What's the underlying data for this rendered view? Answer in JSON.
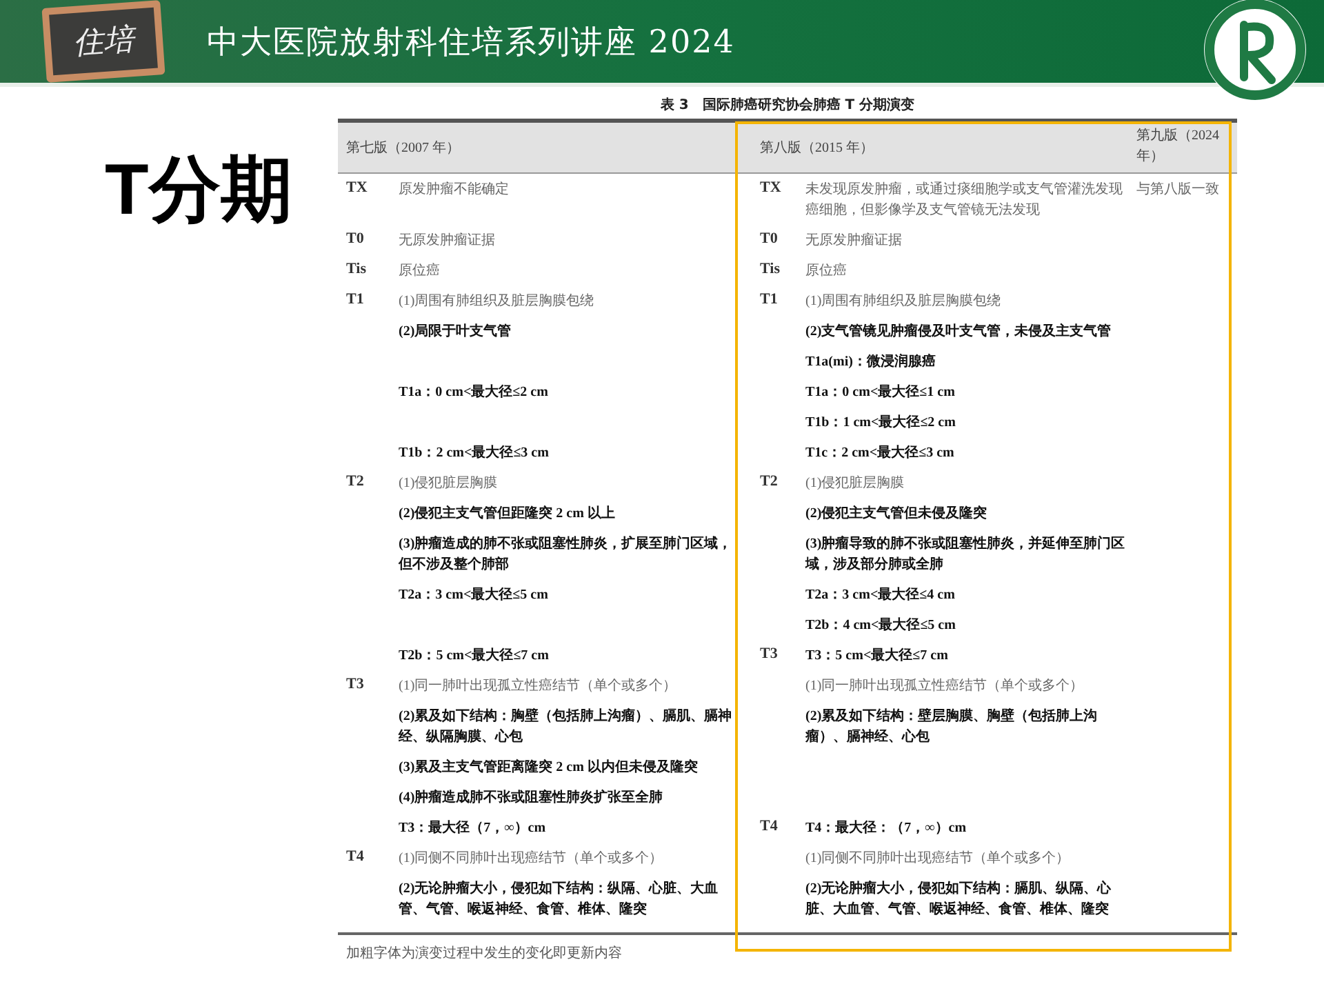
{
  "header": {
    "badge": "住培",
    "title": "中大医院放射科住培系列讲座 2024"
  },
  "heading": "T分期",
  "table": {
    "caption": "表 3　国际肺癌研究协会肺癌 T 分期演变",
    "columns": [
      "第七版（2007 年）",
      "第八版（2015 年）",
      "第九版（2024 年）"
    ],
    "rows": [
      {
        "code_7": "TX",
        "text_7": "原发肿瘤不能确定",
        "bold_7": false,
        "code_8": "TX",
        "text_8": "未发现原发肿瘤，或通过痰细胞学或支气管灌洗发现癌细胞，但影像学及支气管镜无法发现",
        "bold_8": false,
        "text_9": "与第八版一致"
      },
      {
        "code_7": "T0",
        "text_7": "无原发肿瘤证据",
        "bold_7": false,
        "code_8": "T0",
        "text_8": "无原发肿瘤证据",
        "bold_8": false
      },
      {
        "code_7": "Tis",
        "text_7": "原位癌",
        "bold_7": false,
        "code_8": "Tis",
        "text_8": "原位癌",
        "bold_8": false
      },
      {
        "code_7": "T1",
        "text_7": "(1)周围有肺组织及脏层胸膜包绕",
        "bold_7": false,
        "code_8": "T1",
        "text_8": "(1)周围有肺组织及脏层胸膜包绕",
        "bold_8": false
      },
      {
        "text_7": "(2)局限于叶支气管",
        "bold_7": true,
        "text_8": "(2)支气管镜见肿瘤侵及叶支气管，未侵及主支气管",
        "bold_8": true
      },
      {
        "text_8": "T1a(mi)：微浸润腺癌",
        "bold_8": true
      },
      {
        "text_7": "T1a：0 cm<最大径≤2 cm",
        "bold_7": true,
        "text_8": "T1a：0 cm<最大径≤1 cm",
        "bold_8": true
      },
      {
        "text_8": "T1b：1 cm<最大径≤2 cm",
        "bold_8": true
      },
      {
        "text_7": "T1b：2 cm<最大径≤3 cm",
        "bold_7": true,
        "text_8": "T1c：2 cm<最大径≤3 cm",
        "bold_8": true
      },
      {
        "code_7": "T2",
        "text_7": "(1)侵犯脏层胸膜",
        "bold_7": false,
        "code_8": "T2",
        "text_8": "(1)侵犯脏层胸膜",
        "bold_8": false
      },
      {
        "text_7": "(2)侵犯主支气管但距隆突 2 cm 以上",
        "bold_7": true,
        "text_8": "(2)侵犯主支气管但未侵及隆突",
        "bold_8": true
      },
      {
        "text_7": "(3)肿瘤造成的肺不张或阻塞性肺炎，扩展至肺门区域，但不涉及整个肺部",
        "bold_7": true,
        "text_8": "(3)肿瘤导致的肺不张或阻塞性肺炎，并延伸至肺门区域，涉及部分肺或全肺",
        "bold_8": true
      },
      {
        "text_7": "T2a：3 cm<最大径≤5 cm",
        "bold_7": true,
        "text_8": "T2a：3 cm<最大径≤4 cm",
        "bold_8": true
      },
      {
        "text_8": "T2b：4 cm<最大径≤5 cm",
        "bold_8": true
      },
      {
        "text_7": "T2b：5 cm<最大径≤7 cm",
        "bold_7": true,
        "code_8": "T3",
        "text_8": "T3：5 cm<最大径≤7 cm",
        "bold_8": true
      },
      {
        "code_7": "T3",
        "text_7": "(1)同一肺叶出现孤立性癌结节（单个或多个）",
        "bold_7": false,
        "text_8": "(1)同一肺叶出现孤立性癌结节（单个或多个）",
        "bold_8": false
      },
      {
        "text_7": "(2)累及如下结构：胸壁（包括肺上沟瘤）、膈肌、膈神经、纵隔胸膜、心包",
        "bold_7": true,
        "text_8": "(2)累及如下结构：壁层胸膜、胸壁（包括肺上沟瘤）、膈神经、心包",
        "bold_8": true
      },
      {
        "text_7": "(3)累及主支气管距离隆突 2 cm 以内但未侵及隆突",
        "bold_7": true
      },
      {
        "text_7": "(4)肿瘤造成肺不张或阻塞性肺炎扩张至全肺",
        "bold_7": true
      },
      {
        "text_7": "T3：最大径（7，∞）cm",
        "bold_7": true,
        "code_8": "T4",
        "text_8": "T4：最大径：（7，∞）cm",
        "bold_8": true
      },
      {
        "code_7": "T4",
        "text_7": "(1)同侧不同肺叶出现癌结节（单个或多个）",
        "bold_7": false,
        "text_8": "(1)同侧不同肺叶出现癌结节（单个或多个）",
        "bold_8": false
      },
      {
        "text_7": "(2)无论肿瘤大小，侵犯如下结构：纵隔、心脏、大血管、气管、喉返神经、食管、椎体、隆突",
        "bold_7": true,
        "text_8": "(2)无论肿瘤大小，侵犯如下结构：膈肌、纵隔、心脏、大血管、气管、喉返神经、食管、椎体、隆突",
        "bold_8": true
      }
    ],
    "note": "加粗字体为演变过程中发生的变化即更新内容"
  }
}
